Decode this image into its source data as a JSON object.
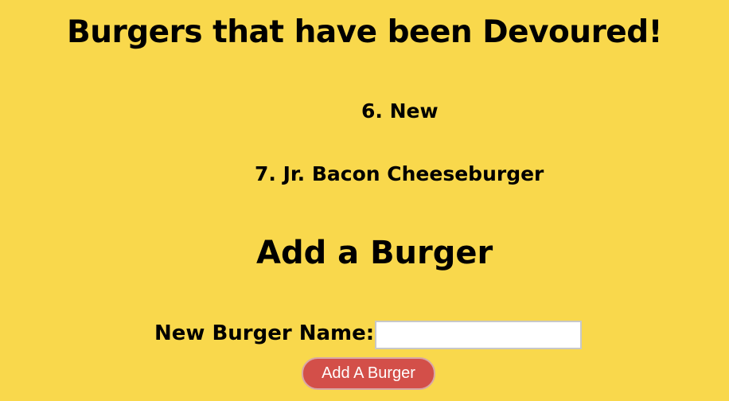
{
  "header": {
    "title": "Burgers that have been Devoured!"
  },
  "devoured": {
    "items": [
      {
        "label": "6. New"
      },
      {
        "label": "7. Jr. Bacon Cheeseburger"
      }
    ]
  },
  "add_section": {
    "title": "Add a Burger",
    "name_label": "New Burger Name:",
    "name_value": "",
    "submit_label": "Add A Burger"
  },
  "colors": {
    "background": "#f9d84c",
    "button": "#d34f49",
    "button_text": "#ffffff",
    "text": "#000000"
  }
}
